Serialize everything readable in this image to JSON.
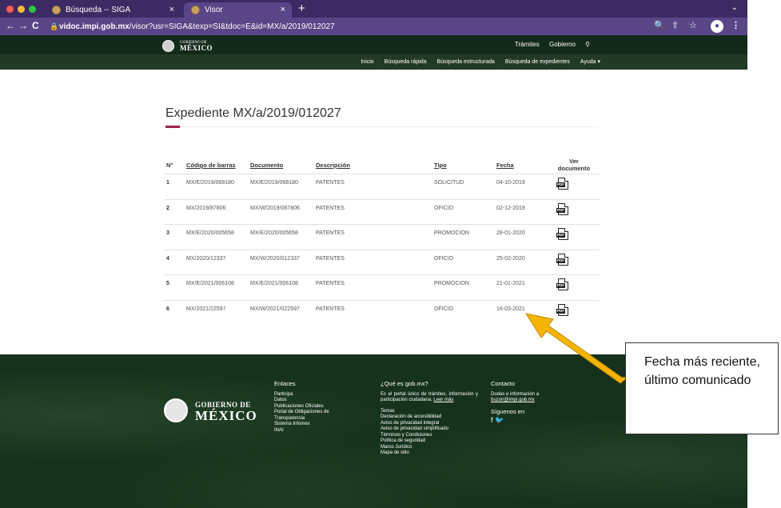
{
  "browser": {
    "tabs": [
      {
        "label": "Búsqueda -- SIGA",
        "close": "×"
      },
      {
        "label": "Visor",
        "close": "×"
      }
    ],
    "new_tab": "+",
    "url_host": "vidoc.impi.gob.mx",
    "url_path": "/visor?usr=SIGA&texp=SI&tdoc=E&id=MX/a/2019/012027",
    "nav": {
      "back": "←",
      "forward": "→",
      "reload": "C"
    }
  },
  "gov_header": {
    "logo_small": "GOBIERNO DE",
    "logo_big": "MÉXICO",
    "top_links": [
      "Trámites",
      "Gobierno"
    ],
    "menu": [
      "Inicio",
      "Búsqueda rápida",
      "Búsqueda estructurada",
      "Búsqueda de expedientes",
      "Ayuda ▾"
    ]
  },
  "page": {
    "title": "Expediente MX/a/2019/012027"
  },
  "table": {
    "headers": {
      "num": "N°",
      "codigo": "Código de barras",
      "documento": "Documento",
      "descripcion": "Descripción",
      "tipo": "Tipo",
      "fecha": "Fecha",
      "ver1": "Ver",
      "ver2": "documento"
    },
    "rows": [
      {
        "n": "1",
        "codigo": "MX/E/2019/068180",
        "documento": "MX/E/2019/068180",
        "descripcion": "PATENTES",
        "tipo": "SOLICITUD",
        "fecha": "04-10-2019",
        "pdf": "PDF"
      },
      {
        "n": "2",
        "codigo": "MX/2019/87806",
        "documento": "MX/W/2019/087806",
        "descripcion": "PATENTES",
        "tipo": "OFICIO",
        "fecha": "02-12-2019",
        "pdf": "PDF"
      },
      {
        "n": "3",
        "codigo": "MX/E/2020/005658",
        "documento": "MX/E/2020/005658",
        "descripcion": "PATENTES",
        "tipo": "PROMOCION",
        "fecha": "28-01-2020",
        "pdf": "PDF"
      },
      {
        "n": "4",
        "codigo": "MX/2020/12337",
        "documento": "MX/W/2020/012337",
        "descripcion": "PATENTES",
        "tipo": "OFICIO",
        "fecha": "25-02-2020",
        "pdf": "PDF"
      },
      {
        "n": "5",
        "codigo": "MX/E/2021/006108",
        "documento": "MX/E/2021/006108",
        "descripcion": "PATENTES",
        "tipo": "PROMOCION",
        "fecha": "21-01-2021",
        "pdf": "PDF"
      },
      {
        "n": "6",
        "codigo": "MX/2021/22597",
        "documento": "MX/W/2021/022597",
        "descripcion": "PATENTES",
        "tipo": "OFICIO",
        "fecha": "16-03-2021",
        "pdf": "PDF"
      }
    ]
  },
  "footer": {
    "logo_l1": "GOBIERNO DE",
    "logo_l2": "MÉXICO",
    "enlaces_title": "Enlaces",
    "enlaces": [
      "Participa",
      "Datos",
      "Publicaciones Oficiales",
      "Portal de Obligaciones de",
      "Transparencia",
      "Sistema Infomex",
      "INAI"
    ],
    "que_es_title": "¿Qué es gob.mx?",
    "que_es_text": "Es el portal único de trámites, información y participación ciudadana.",
    "leer_mas": "Leer más",
    "temas": [
      "Temas",
      "Declaración de accesibilidad",
      "Aviso de privacidad integral",
      "Aviso de privacidad simplificado",
      "Términos y Condiciones",
      "Política de seguridad",
      "Marco Jurídico",
      "Mapa de sitio"
    ],
    "contacto_title": "Contacto",
    "contacto_text": "Dudas e información a",
    "contacto_email": "buzon@impi.gob.mx",
    "siguenos": "Síguenos en",
    "social": "f 🐦"
  },
  "annotation": {
    "text": "Fecha más reciente, último comunicado",
    "arrow_color": "#f5b400"
  }
}
